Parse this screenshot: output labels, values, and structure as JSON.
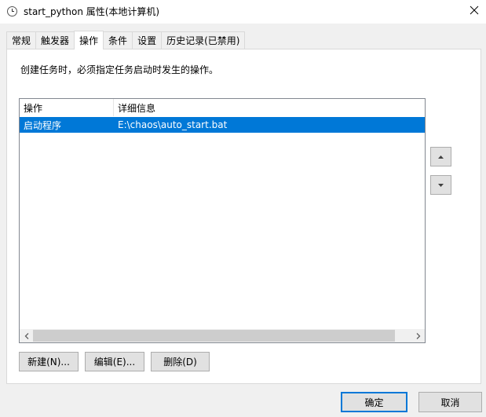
{
  "window": {
    "title": "start_python 属性(本地计算机)",
    "icon": "clock-icon",
    "close_glyph": "close-icon"
  },
  "tabs": [
    {
      "label": "常规",
      "active": false
    },
    {
      "label": "触发器",
      "active": false
    },
    {
      "label": "操作",
      "active": true
    },
    {
      "label": "条件",
      "active": false
    },
    {
      "label": "设置",
      "active": false
    },
    {
      "label": "历史记录(已禁用)",
      "active": false
    }
  ],
  "panel": {
    "description": "创建任务时，必须指定任务启动时发生的操作。"
  },
  "list": {
    "columns": [
      "操作",
      "详细信息"
    ],
    "rows": [
      {
        "action": "启动程序",
        "details": "E:\\chaos\\auto_start.bat",
        "selected": true
      }
    ]
  },
  "buttons": {
    "new": "新建(N)...",
    "edit": "编辑(E)...",
    "delete": "删除(D)",
    "ok": "确定",
    "cancel": "取消"
  },
  "colors": {
    "selection": "#0078d7",
    "default_button_border": "#0078d7"
  }
}
